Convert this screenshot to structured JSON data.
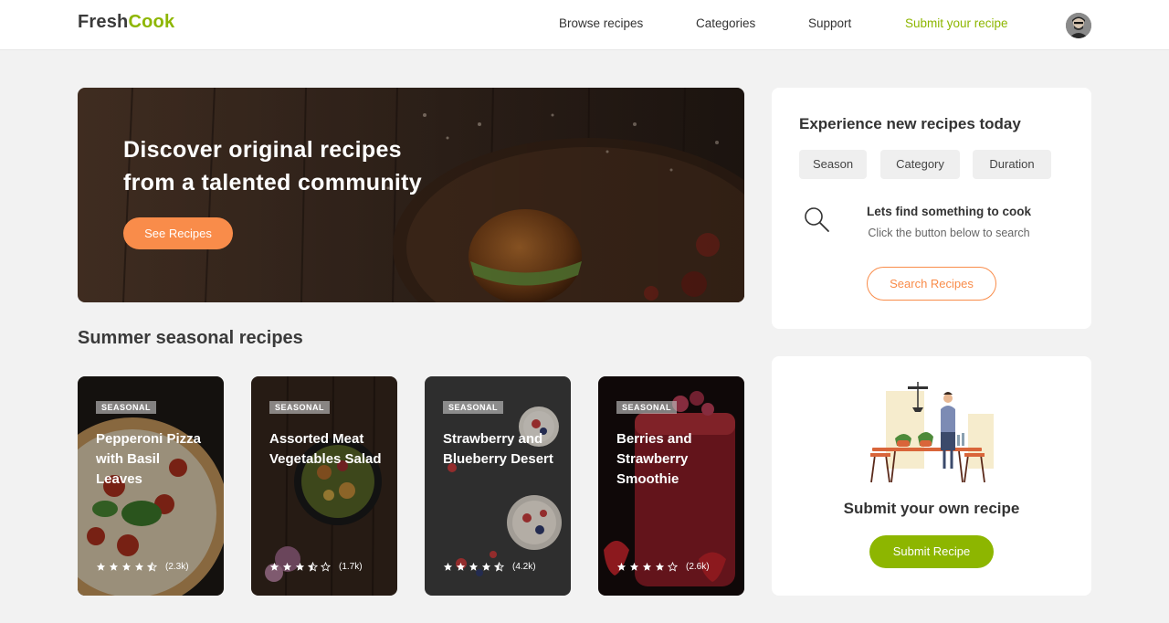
{
  "header": {
    "logo_part1": "Fresh",
    "logo_part2": "Cook",
    "nav": [
      "Browse recipes",
      "Categories",
      "Support",
      "Submit your recipe"
    ]
  },
  "hero": {
    "line1": "Discover original recipes",
    "line2": "from a talented community",
    "button": "See Recipes"
  },
  "section": {
    "title": "Summer seasonal recipes"
  },
  "cards": [
    {
      "badge": "SEASONAL",
      "title": "Pepperoni Pizza with Basil Leaves",
      "rating": 4.5,
      "count": "(2.3k)"
    },
    {
      "badge": "SEASONAL",
      "title": "Assorted Meat Vegetables Salad",
      "rating": 3.5,
      "count": "(1.7k)"
    },
    {
      "badge": "SEASONAL",
      "title": "Strawberry and Blueberry Desert",
      "rating": 4.5,
      "count": "(4.2k)"
    },
    {
      "badge": "SEASONAL",
      "title": "Berries and Strawberry Smoothie",
      "rating": 4,
      "count": "(2.6k)"
    }
  ],
  "explore": {
    "title": "Experience new recipes today",
    "filters": [
      "Season",
      "Category",
      "Duration"
    ],
    "find_title": "Lets find something to cook",
    "find_sub": "Click the button below to search",
    "button": "Search Recipes"
  },
  "submit": {
    "title": "Submit your own recipe",
    "button": "Submit Recipe"
  },
  "colors": {
    "accent_green": "#8db600",
    "accent_orange": "#f98c4a"
  }
}
